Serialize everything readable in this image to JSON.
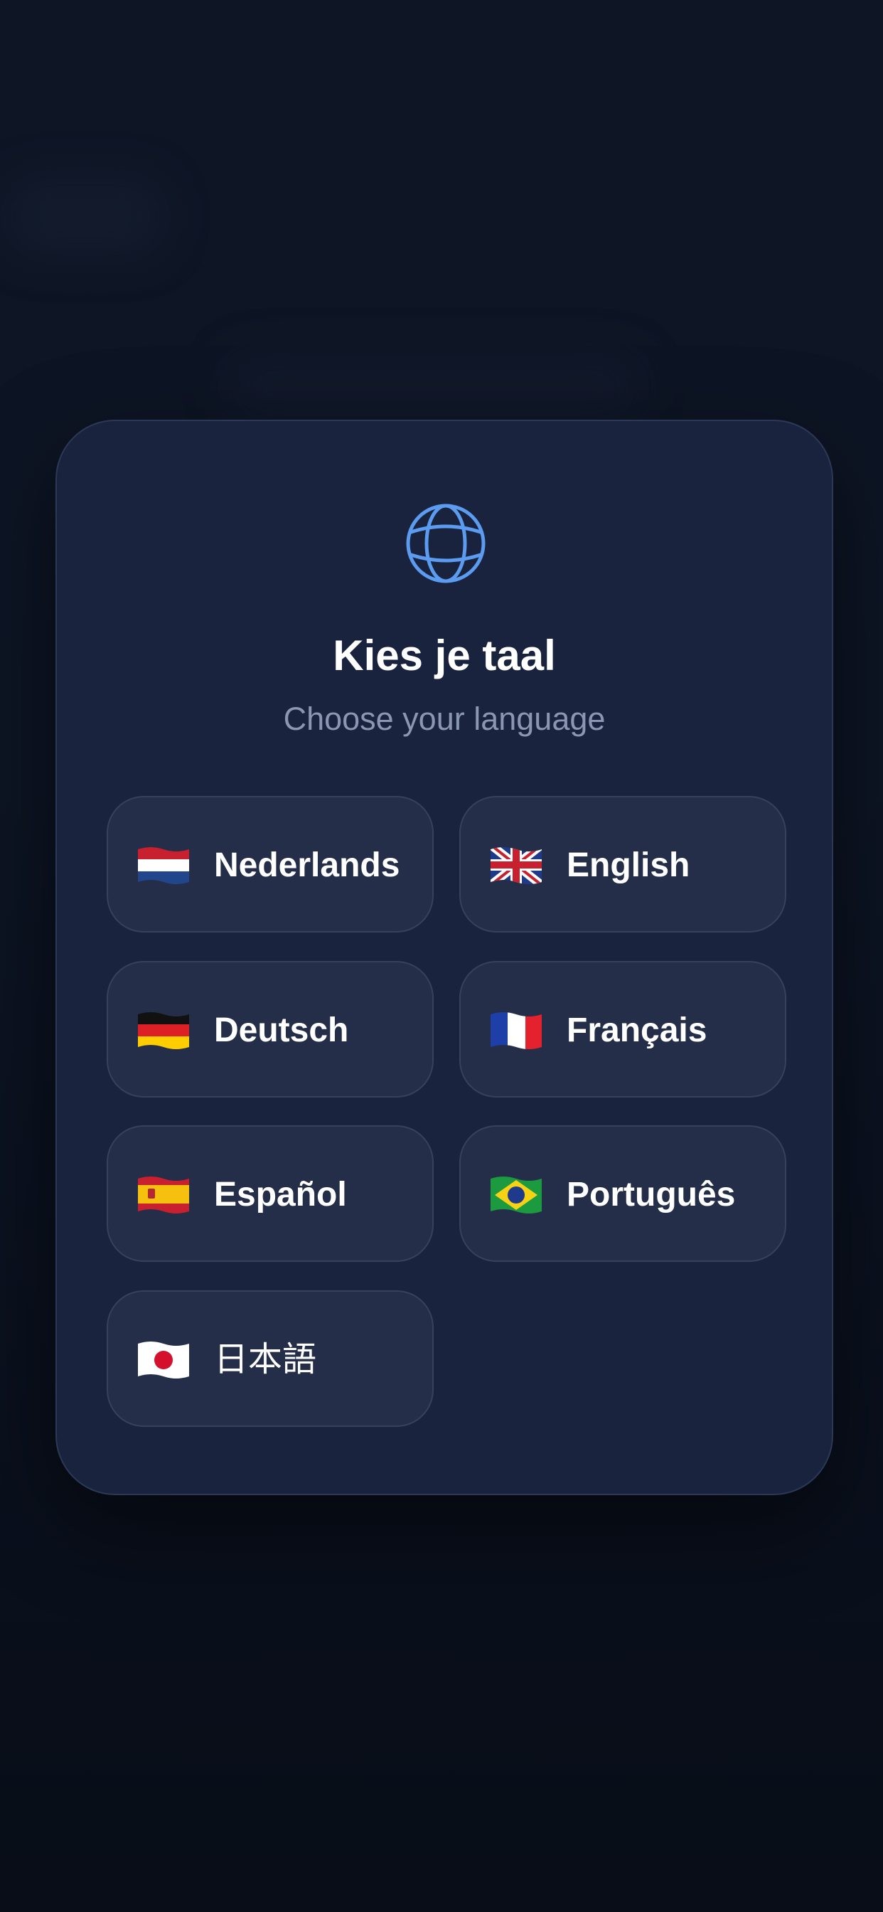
{
  "dialog": {
    "title": "Kies je taal",
    "subtitle": "Choose your language",
    "icon": "globe-icon",
    "accent_color": "#5b9bf0"
  },
  "languages": [
    {
      "label": "Nederlands",
      "flag": "netherlands-flag"
    },
    {
      "label": "English",
      "flag": "united-kingdom-flag"
    },
    {
      "label": "Deutsch",
      "flag": "germany-flag"
    },
    {
      "label": "Français",
      "flag": "france-flag"
    },
    {
      "label": "Español",
      "flag": "spain-flag"
    },
    {
      "label": "Português",
      "flag": "brazil-flag"
    },
    {
      "label": "日本語",
      "flag": "japan-flag"
    }
  ]
}
